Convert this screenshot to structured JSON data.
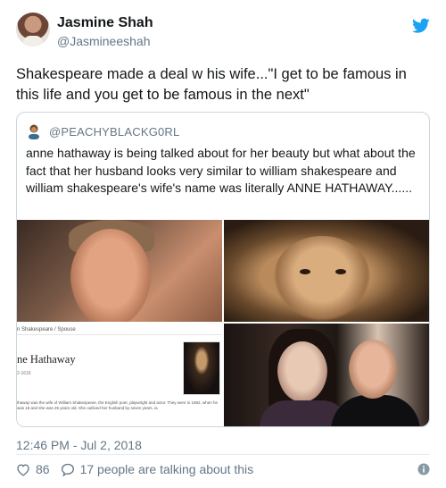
{
  "author": {
    "display_name": "Jasmine Shah",
    "handle": "@Jasmineeshah"
  },
  "tweet": {
    "text": "Shakespeare made a deal w his wife...\"I get to be famous in this life and you get to be famous in the next\""
  },
  "quoted_tweet": {
    "handle": "@PEACHYBLACKG0RL",
    "text": "anne hathaway is being talked about for her beauty but what about the fact that her husband looks very similar to william shakespeare and william shakespeare's wife's name was literally ANNE HATHAWAY......",
    "wiki_card": {
      "breadcrumb": "n Shakespeare / Spouse",
      "title": "ne Hathaway",
      "dates": "2-1616",
      "description": "thaway was the wife of William Shakespeare, the English poet, playwright and actor. They were in 1582, when he was 18 and she was 26 years old. She outlived her husband by seven years. ia"
    }
  },
  "meta": {
    "timestamp": "12:46 PM - Jul 2, 2018",
    "like_count": "86",
    "talking_text": "17 people are talking about this"
  },
  "icons": {
    "brand": "twitter-bird-icon",
    "like": "heart-icon",
    "reply": "speech-bubble-icon",
    "info": "info-icon"
  },
  "colors": {
    "brand": "#1da1f2",
    "text": "#14171a",
    "muted": "#657786",
    "border": "#ccd6dd"
  }
}
